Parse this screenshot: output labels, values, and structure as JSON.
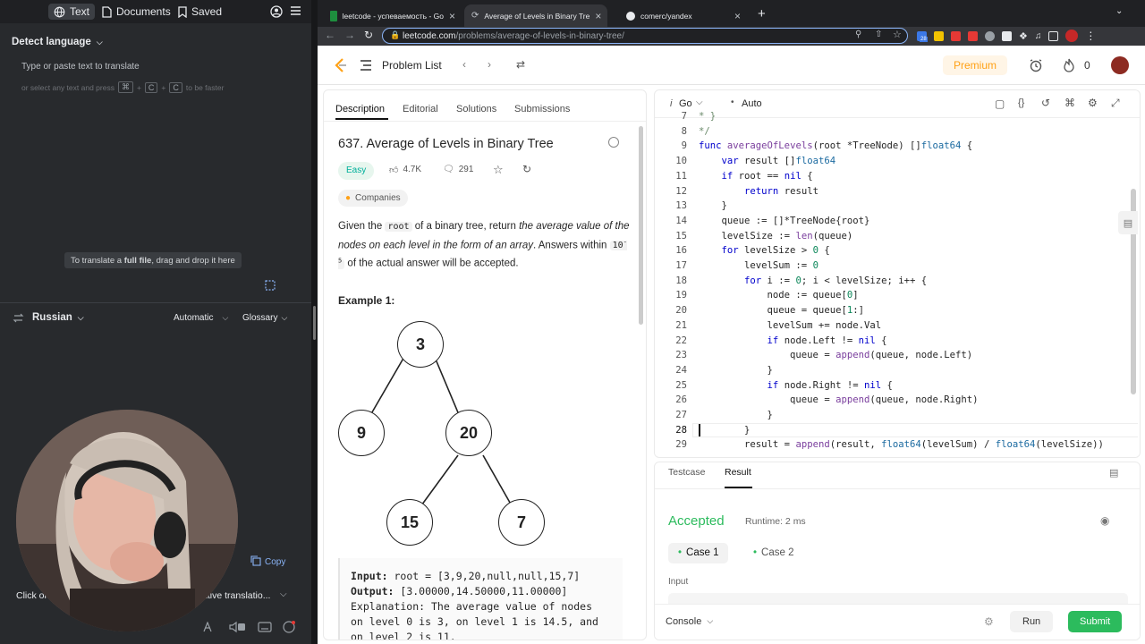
{
  "translator": {
    "tabs": [
      "Text",
      "Documents",
      "Saved"
    ],
    "detect_language": "Detect language",
    "placeholder": "Type or paste text to translate",
    "hint_prefix": "or select any text and press",
    "hint_keys": [
      "⌘",
      "C",
      "C"
    ],
    "hint_suffix": "to be faster",
    "file_hint_pre": "To translate a",
    "file_hint_bold": "full file",
    "file_hint_post": ", drag and drop it here",
    "target_language": "Russian",
    "formality": "Automatic",
    "glossary": "Glossary",
    "copy_label": "Copy",
    "footer_left": "Click on",
    "footer_right": "ative translatio..."
  },
  "browser": {
    "tabs": [
      {
        "title": "leetcode - успеваемость - Go"
      },
      {
        "title": "Average of Levels in Binary Tre"
      },
      {
        "title": "comerc/yandex"
      }
    ],
    "url_host": "leetcode.com",
    "url_path": "/problems/average-of-levels-in-binary-tree/",
    "ext_badge": "28"
  },
  "nav": {
    "problem_list": "Problem List",
    "premium": "Premium",
    "streak": "0",
    "premium_color": "#ffa116"
  },
  "tabs": {
    "description": "Description",
    "editorial": "Editorial",
    "solutions": "Solutions",
    "submissions": "Submissions"
  },
  "problem": {
    "title": "637. Average of Levels in Binary Tree",
    "difficulty": "Easy",
    "likes": "4.7K",
    "comments": "291",
    "companies": "Companies",
    "desc1": "Given the",
    "desc_code": "root",
    "desc2": "of a binary tree, return",
    "desc_italic": "the average value of the nodes on each level in the form of an array",
    "desc3": ". Answers within",
    "desc_code2": "10",
    "desc_sup": "-5",
    "desc4": "of the actual answer will be accepted.",
    "example_title": "Example 1:",
    "tree": [
      "3",
      "9",
      "20",
      "15",
      "7"
    ],
    "ex_input_label": "Input:",
    "ex_input": "root = [3,9,20,null,null,15,7]",
    "ex_output_label": "Output:",
    "ex_output": "[3.00000,14.50000,11.00000]",
    "ex_expl1": "Explanation: The average value of nodes",
    "ex_expl2": "on level 0 is 3, on level 1 is 14.5, and",
    "ex_expl3": "on level 2 is 11."
  },
  "editor": {
    "language": "Go",
    "mode": "Auto",
    "line_numbers": [
      "7",
      "8",
      "9",
      "10",
      "11",
      "12",
      "13",
      "14",
      "15",
      "16",
      "17",
      "18",
      "19",
      "20",
      "21",
      "22",
      "23",
      "24",
      "25",
      "26",
      "27",
      "28",
      "29"
    ],
    "current_line": "28"
  },
  "result": {
    "tab_testcase": "Testcase",
    "tab_result": "Result",
    "status": "Accepted",
    "runtime": "Runtime: 2 ms",
    "case1": "Case 1",
    "case2": "Case 2",
    "input_label": "Input",
    "console": "Console",
    "run": "Run",
    "submit": "Submit",
    "accepted_color": "#2cbb5d"
  }
}
